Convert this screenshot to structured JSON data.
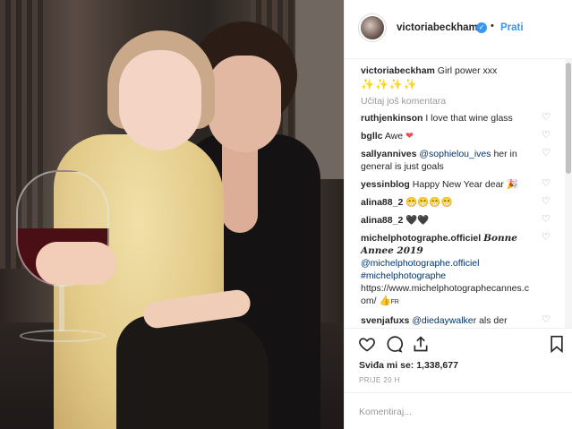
{
  "post": {
    "username": "victoriabeckham",
    "follow_label": "Prati",
    "separator": "•"
  },
  "caption": {
    "username": "victoriabeckham",
    "text": "Girl power xxx",
    "emojis": "✨✨✨✨"
  },
  "load_more": "Učitaj još komentara",
  "comments": [
    {
      "user": "ruthjenkinson",
      "text": "I love that wine glass"
    },
    {
      "user": "bgllc",
      "text": "Awe",
      "emoji": "❤"
    },
    {
      "user": "sallyannives",
      "mention": "@sophielou_ives",
      "text": "her in general is just goals"
    },
    {
      "user": "yessinblog",
      "text": "Happy New Year dear",
      "emoji": "🎉"
    },
    {
      "user": "alina88_2",
      "emoji": "😁😁😁😁"
    },
    {
      "user": "alina88_2",
      "emoji": "🖤🖤"
    },
    {
      "user": "michelphotographe.officiel",
      "fancy": "Bonne Annee 2019",
      "mention": "@michelphotographe.officiel",
      "hashtag": "#michelphotographe",
      "url": "https://www.michelphotographecannes.com/",
      "emoji": "👍",
      "flag": "FR"
    },
    {
      "user": "svenjafuxs",
      "mention": "@diedaywalker",
      "text": "als der Koop!!!!!"
    }
  ],
  "likes": {
    "label": "Sviđa mi se:",
    "count": "1,338,677"
  },
  "timestamp": "PRIJE 20 H",
  "add_comment_placeholder": "Komentiraj...",
  "colors": {
    "accent": "#3897f0",
    "text": "#262626",
    "muted": "#999999",
    "link": "#003569",
    "heart_red": "#ed4956"
  }
}
